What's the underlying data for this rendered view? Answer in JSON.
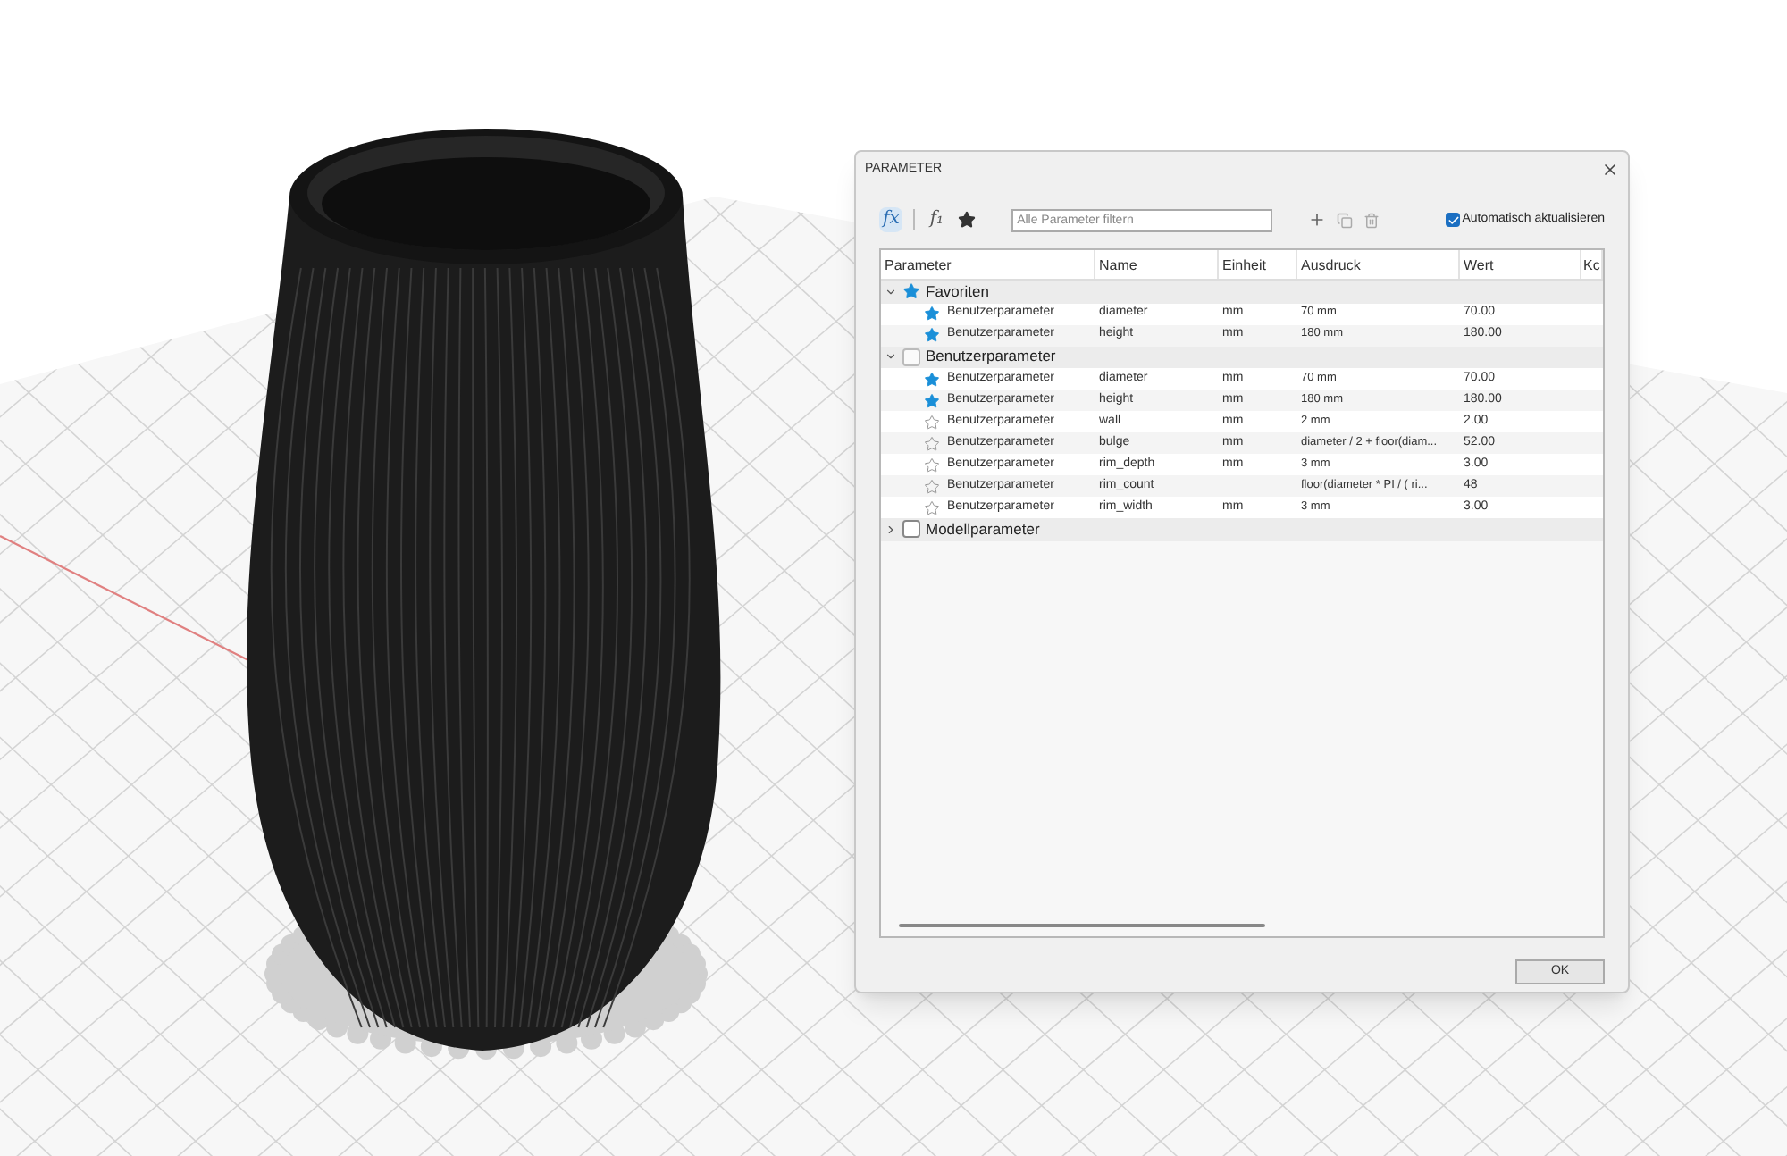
{
  "dialog": {
    "title": "PARAMETER",
    "toolbar": [
      {
        "glyph": "fx",
        "selected": true
      },
      {
        "glyph": "f₁",
        "selected": false
      }
    ],
    "filter": {
      "placeholder": "Alle Parameter filtern"
    },
    "auto_update": {
      "label": "Automatisch aktualisieren",
      "checked": true
    },
    "columns": [
      "Parameter",
      "Name",
      "Einheit",
      "Ausdruck",
      "Wert",
      "Kc"
    ],
    "groups": [
      {
        "kind": "favorites",
        "label": "Favoriten",
        "expanded": true,
        "rows": [
          {
            "favorite": true,
            "parameter": "Benutzerparameter",
            "name": "diameter",
            "unit": "mm",
            "expression": "70 mm",
            "value": "70.00"
          },
          {
            "favorite": true,
            "parameter": "Benutzerparameter",
            "name": "height",
            "unit": "mm",
            "expression": "180 mm",
            "value": "180.00"
          }
        ]
      },
      {
        "kind": "user",
        "label": "Benutzerparameter",
        "expanded": true,
        "rows": [
          {
            "favorite": true,
            "parameter": "Benutzerparameter",
            "name": "diameter",
            "unit": "mm",
            "expression": "70 mm",
            "value": "70.00"
          },
          {
            "favorite": true,
            "parameter": "Benutzerparameter",
            "name": "height",
            "unit": "mm",
            "expression": "180 mm",
            "value": "180.00"
          },
          {
            "favorite": false,
            "parameter": "Benutzerparameter",
            "name": "wall",
            "unit": "mm",
            "expression": "2 mm",
            "value": "2.00"
          },
          {
            "favorite": false,
            "parameter": "Benutzerparameter",
            "name": "bulge",
            "unit": "mm",
            "expression": "diameter / 2 + floor(diam...",
            "value": "52.00"
          },
          {
            "favorite": false,
            "parameter": "Benutzerparameter",
            "name": "rim_depth",
            "unit": "mm",
            "expression": "3 mm",
            "value": "3.00"
          },
          {
            "favorite": false,
            "parameter": "Benutzerparameter",
            "name": "rim_count",
            "expression": "floor(diameter * PI / ( ri...",
            "value": "48"
          },
          {
            "favorite": false,
            "parameter": "Benutzerparameter",
            "name": "rim_width",
            "unit": "mm",
            "expression": "3 mm",
            "value": "3.00"
          }
        ]
      },
      {
        "kind": "model",
        "label": "Modellparameter",
        "expanded": false
      }
    ],
    "ok_button": "OK"
  }
}
